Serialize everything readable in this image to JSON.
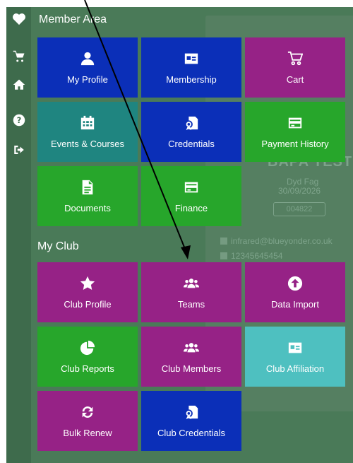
{
  "header": {
    "title": "Member Area"
  },
  "sidebar": {
    "items": [
      {
        "icon": "cart-icon"
      },
      {
        "icon": "home-icon"
      },
      {
        "icon": "help-icon"
      },
      {
        "icon": "logout-icon"
      }
    ]
  },
  "background": {
    "name": "BAPA TEST",
    "sub": "Dyd Fag",
    "date": "30/09/2026",
    "code": "004822",
    "email": "infrared@blueyonder.co.uk",
    "phone": "12345645454"
  },
  "member_area": {
    "tiles": [
      {
        "label": "My Profile",
        "icon": "user-icon",
        "color": "#0b2fb8"
      },
      {
        "label": "Membership",
        "icon": "id-card-icon",
        "color": "#0b2fb8"
      },
      {
        "label": "Cart",
        "icon": "cart-icon",
        "color": "#962286"
      },
      {
        "label": "Events & Courses",
        "icon": "calendar-icon",
        "color": "#1f8580"
      },
      {
        "label": "Credentials",
        "icon": "credential-icon",
        "color": "#0b2fb8"
      },
      {
        "label": "Payment History",
        "icon": "credit-card-icon",
        "color": "#27a62b"
      },
      {
        "label": "Documents",
        "icon": "document-icon",
        "color": "#27a62b"
      },
      {
        "label": "Finance",
        "icon": "credit-card-icon",
        "color": "#27a62b"
      }
    ]
  },
  "my_club": {
    "title": "My Club",
    "tiles": [
      {
        "label": "Club Profile",
        "icon": "star-icon",
        "color": "#962286"
      },
      {
        "label": "Teams",
        "icon": "users-icon",
        "color": "#962286"
      },
      {
        "label": "Data Import",
        "icon": "upload-icon",
        "color": "#962286"
      },
      {
        "label": "Club Reports",
        "icon": "pie-chart-icon",
        "color": "#27a62b"
      },
      {
        "label": "Club Members",
        "icon": "users-icon",
        "color": "#962286"
      },
      {
        "label": "Club Affiliation",
        "icon": "id-card-icon",
        "color": "#4ec0c0"
      },
      {
        "label": "Bulk Renew",
        "icon": "sync-icon",
        "color": "#962286"
      },
      {
        "label": "Club Credentials",
        "icon": "credential-icon",
        "color": "#0b2fb8"
      }
    ]
  }
}
